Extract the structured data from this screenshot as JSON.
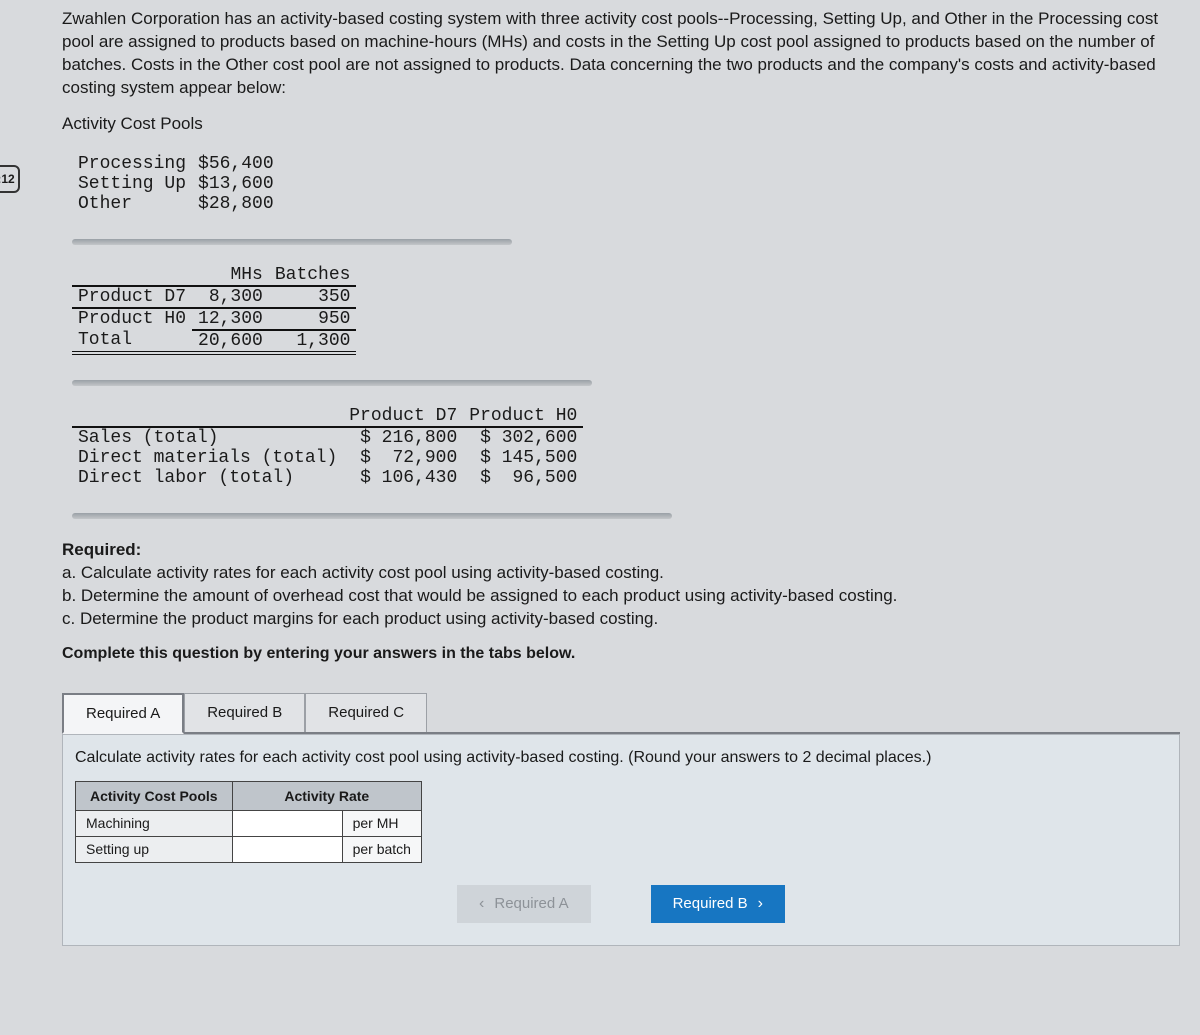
{
  "timer": ":12",
  "intro": "Zwahlen Corporation has an activity-based costing system with three activity cost pools--Processing, Setting Up, and Other in the Processing cost pool are assigned to products based on machine-hours (MHs) and costs in the Setting Up cost pool assigned to products based on the number of batches. Costs in the Other cost pool are not assigned to products. Data concerning the two products and the company's costs and activity-based costing system appear below:",
  "section1_title": "Activity Cost Pools",
  "pools": {
    "rows": [
      {
        "name": "Processing",
        "amount": "$56,400"
      },
      {
        "name": "Setting Up",
        "amount": "$13,600"
      },
      {
        "name": "Other",
        "amount": "$28,800"
      }
    ]
  },
  "driver_table": {
    "col1": "MHs",
    "col2": "Batches",
    "rows": [
      {
        "name": "Product D7",
        "mhs": "8,300",
        "batches": "350"
      },
      {
        "name": "Product H0",
        "mhs": "12,300",
        "batches": "950"
      }
    ],
    "total_label": "Total",
    "total_mhs": "20,600",
    "total_batches": "1,300"
  },
  "product_table": {
    "col1": "Product D7",
    "col2": "Product H0",
    "rows": [
      {
        "name": "Sales (total)",
        "d7": "$ 216,800",
        "h0": "$ 302,600"
      },
      {
        "name": "Direct materials (total)",
        "d7": "$  72,900",
        "h0": "$ 145,500"
      },
      {
        "name": "Direct labor (total)",
        "d7": "$ 106,430",
        "h0": "$  96,500"
      }
    ]
  },
  "required": {
    "heading": "Required:",
    "a": "a. Calculate activity rates for each activity cost pool using activity-based costing.",
    "b": "b. Determine the amount of overhead cost that would be assigned to each product using activity-based costing.",
    "c": "c. Determine the product margins for each product using activity-based costing."
  },
  "instruct": "Complete this question by entering your answers in the tabs below.",
  "tabs": {
    "a": "Required A",
    "b": "Required B",
    "c": "Required C"
  },
  "panelA": {
    "hint": "Calculate activity rates for each activity cost pool using activity-based costing. (Round your answers to 2 decimal places.)",
    "head1": "Activity Cost Pools",
    "head2": "Activity Rate",
    "row1_label": "Machining",
    "row1_unit": "per MH",
    "row2_label": "Setting up",
    "row2_unit": "per batch"
  },
  "nav": {
    "prev": "Required A",
    "next": "Required B"
  },
  "chart_data": {
    "type": "table",
    "cost_pools": {
      "Processing": 56400,
      "Setting Up": 13600,
      "Other": 28800
    },
    "drivers": {
      "Product D7": {
        "MHs": 8300,
        "Batches": 350
      },
      "Product H0": {
        "MHs": 12300,
        "Batches": 950
      },
      "Total": {
        "MHs": 20600,
        "Batches": 1300
      }
    },
    "products": {
      "Product D7": {
        "Sales": 216800,
        "Direct materials": 72900,
        "Direct labor": 106430
      },
      "Product H0": {
        "Sales": 302600,
        "Direct materials": 145500,
        "Direct labor": 96500
      }
    }
  }
}
